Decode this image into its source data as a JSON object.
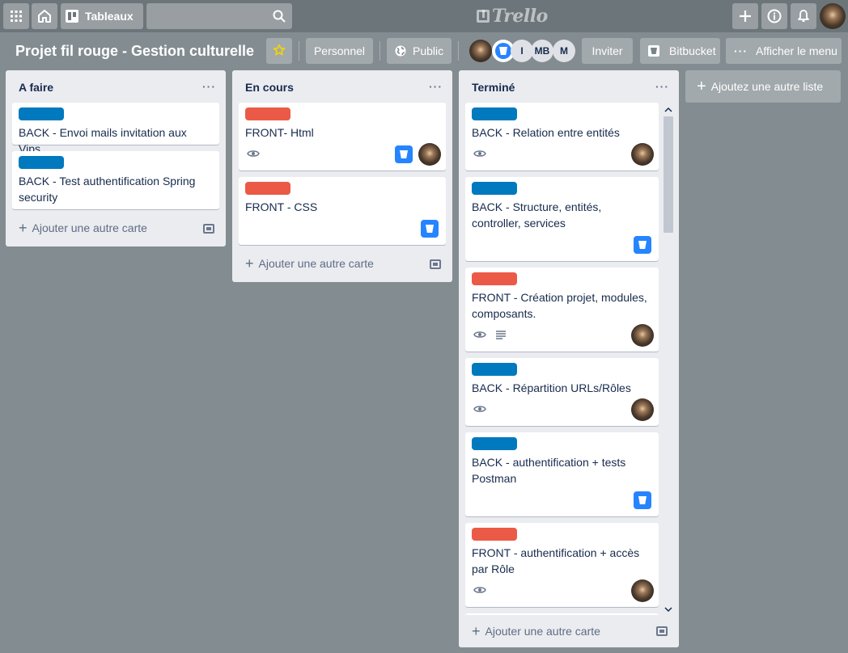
{
  "topbar": {
    "boards_label": "Tableaux",
    "search_value": "",
    "logo_text": "Trello"
  },
  "header": {
    "title": "Projet fil rouge - Gestion culturelle",
    "team_label": "Personnel",
    "visibility_label": "Public",
    "members": [
      "I",
      "MB",
      "M"
    ],
    "invite_label": "Inviter",
    "bitbucket_label": "Bitbucket",
    "menu_label": "Afficher le menu"
  },
  "colors": {
    "back_label": "#0079bf",
    "front_label": "#eb5a46",
    "bitbucket": "#2684ff"
  },
  "lists": [
    {
      "title": "A faire",
      "cards": [
        {
          "title": "BACK - Envoi mails invitation aux Vips",
          "label_color": "blue"
        },
        {
          "title": "BACK - Test authentification Spring security",
          "label_color": "blue"
        }
      ],
      "add_label": "Ajouter une autre carte"
    },
    {
      "title": "En cours",
      "cards": [
        {
          "title": "FRONT- Html",
          "label_color": "red",
          "badges": [
            "eye-icon"
          ],
          "bitbucket": true,
          "member_avatar": true
        },
        {
          "title": "FRONT - CSS",
          "label_color": "red",
          "bitbucket": true
        }
      ],
      "add_label": "Ajouter une autre carte"
    },
    {
      "title": "Terminé",
      "cards": [
        {
          "title": "BACK - Relation entre entités",
          "label_color": "blue",
          "badges": [
            "eye-icon"
          ],
          "member_avatar": true
        },
        {
          "title": "BACK - Structure, entités, controller, services",
          "label_color": "blue",
          "bitbucket": true
        },
        {
          "title": "FRONT - Création projet, modules, composants.",
          "label_color": "red",
          "badges": [
            "eye-icon",
            "description-icon"
          ],
          "member_avatar": true
        },
        {
          "title": "BACK - Répartition URLs/Rôles",
          "label_color": "blue",
          "badges": [
            "eye-icon"
          ],
          "member_avatar": true
        },
        {
          "title": "BACK - authentification + tests Postman",
          "label_color": "blue",
          "bitbucket": true
        },
        {
          "title": "FRONT - authentification + accès par Rôle",
          "label_color": "red",
          "badges": [
            "eye-icon"
          ],
          "member_avatar": true
        }
      ],
      "add_label": "Ajouter une autre carte"
    }
  ],
  "add_list_label": "Ajoutez une autre liste"
}
